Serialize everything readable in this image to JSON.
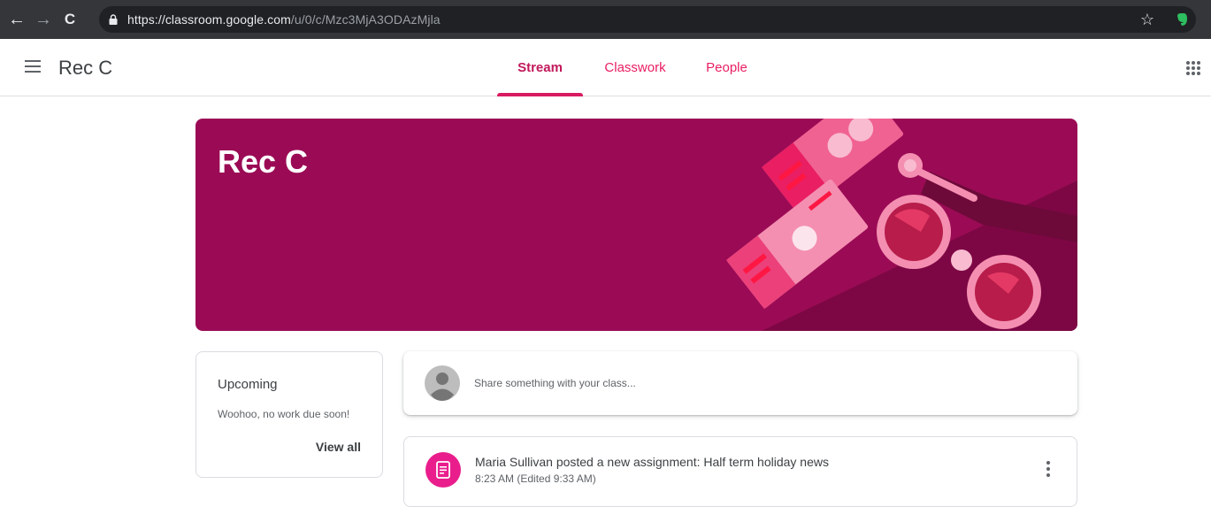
{
  "browser": {
    "url_host": "https://classroom.google.com",
    "url_path": "/u/0/c/Mzc3MjA3ODAzMjla",
    "back_glyph": "←",
    "forward_glyph": "→",
    "reload_glyph": "C",
    "star_glyph": "☆"
  },
  "appbar": {
    "class_name": "Rec C",
    "tabs": [
      {
        "label": "Stream",
        "active": true
      },
      {
        "label": "Classwork",
        "active": false
      },
      {
        "label": "People",
        "active": false
      }
    ]
  },
  "banner": {
    "title": "Rec C",
    "color": "#9b0b55"
  },
  "upcoming": {
    "title": "Upcoming",
    "message": "Woohoo, no work due soon!",
    "view_all": "View all"
  },
  "share": {
    "placeholder": "Share something with your class..."
  },
  "post": {
    "title": "Maria Sullivan posted a new assignment: Half term holiday news",
    "time": "8:23 AM (Edited 9:33 AM)",
    "icon_color": "#e91e8c"
  },
  "colors": {
    "accent": "#e91e63",
    "chrome_bg": "#35363a"
  },
  "icons": {
    "menu": "hamburger-menu-icon",
    "apps": "apps-grid-icon",
    "lock": "lock-icon",
    "assignment": "assignment-icon",
    "more": "more-vertical-icon"
  }
}
